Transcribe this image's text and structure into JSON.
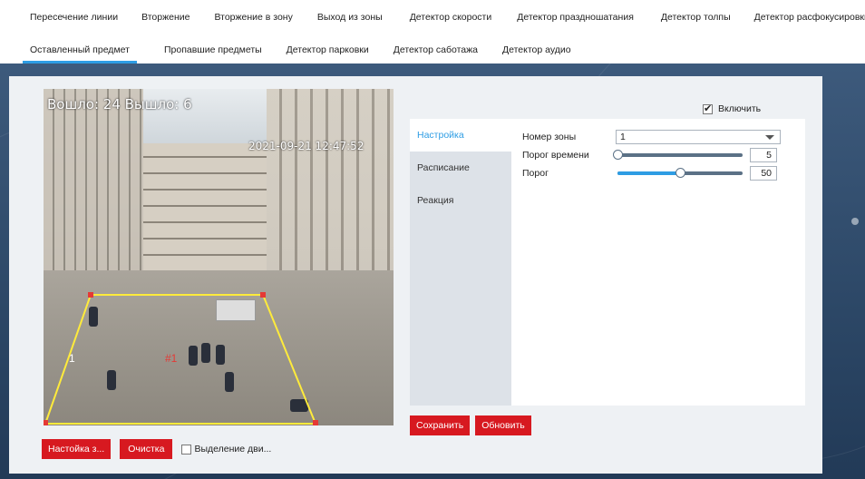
{
  "tabs": {
    "row1": [
      {
        "label": "Пересечение линии"
      },
      {
        "label": "Вторжение"
      },
      {
        "label": "Вторжение в зону"
      },
      {
        "label": "Выход из зоны"
      },
      {
        "label": "Детектор скорости"
      },
      {
        "label": "Детектор праздношатания"
      },
      {
        "label": "Детектор толпы"
      },
      {
        "label": "Детектор расфокусировки"
      }
    ],
    "row2": [
      {
        "label": "Оставленный предмет",
        "active": true
      },
      {
        "label": "Пропавшие предметы"
      },
      {
        "label": "Детектор парковки"
      },
      {
        "label": "Детектор саботажа"
      },
      {
        "label": "Детектор аудио"
      }
    ]
  },
  "video": {
    "osd_left": "Вошло: 24  Вышло: 6",
    "osd_right": "2021-09-21 12:47:52",
    "zone_label": "#1",
    "zone_number": "1",
    "zone_color": "#ffeb3b",
    "zone_label_color": "#e53935"
  },
  "video_buttons": {
    "zone_setup": "Настойка з...",
    "clear": "Очистка",
    "motion_highlight": "Выделение дви..."
  },
  "enable": {
    "label": "Включить",
    "checked": true
  },
  "side_tabs": [
    {
      "label": "Настройка",
      "active": true
    },
    {
      "label": "Расписание"
    },
    {
      "label": "Реакция"
    }
  ],
  "settings": {
    "zone_number_label": "Номер зоны",
    "zone_number_value": "1",
    "time_threshold_label": "Порог времени",
    "time_threshold_value": "5",
    "time_threshold_fraction": 0.0,
    "threshold_label": "Порог",
    "threshold_value": "50",
    "threshold_fraction": 0.5
  },
  "actions": {
    "save": "Сохранить",
    "refresh": "Обновить"
  },
  "colors": {
    "accent": "#2e9de4",
    "button_red": "#d71920",
    "background": "#2c4766"
  }
}
